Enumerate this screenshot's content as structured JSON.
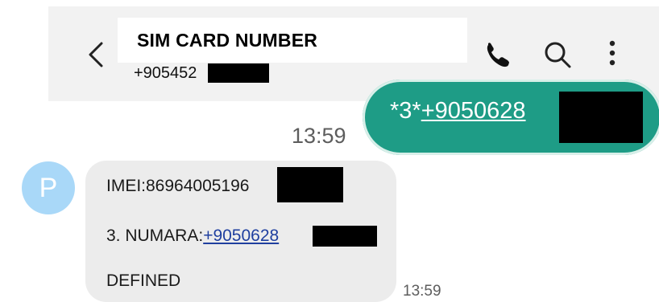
{
  "header": {
    "title": "SIM CARD NUMBER",
    "contact_number": "+905452"
  },
  "icons": {
    "back": "chevron-left-icon",
    "call": "phone-icon",
    "search": "search-icon",
    "menu": "more-vertical-icon"
  },
  "sent_message": {
    "prefix": "*3*",
    "number": "+9050628",
    "time": "13:59"
  },
  "received_message": {
    "avatar_letter": "P",
    "imei_line": "IMEI:86964005196",
    "numara_label": "3. NUMARA:",
    "numara_number": "+9050628",
    "status": "DEFINED",
    "time": "13:59"
  },
  "colors": {
    "sent_bubble": "#1e9c86",
    "received_bubble": "#ececec",
    "avatar": "#a9d8f8",
    "link": "#1f3f9f"
  }
}
